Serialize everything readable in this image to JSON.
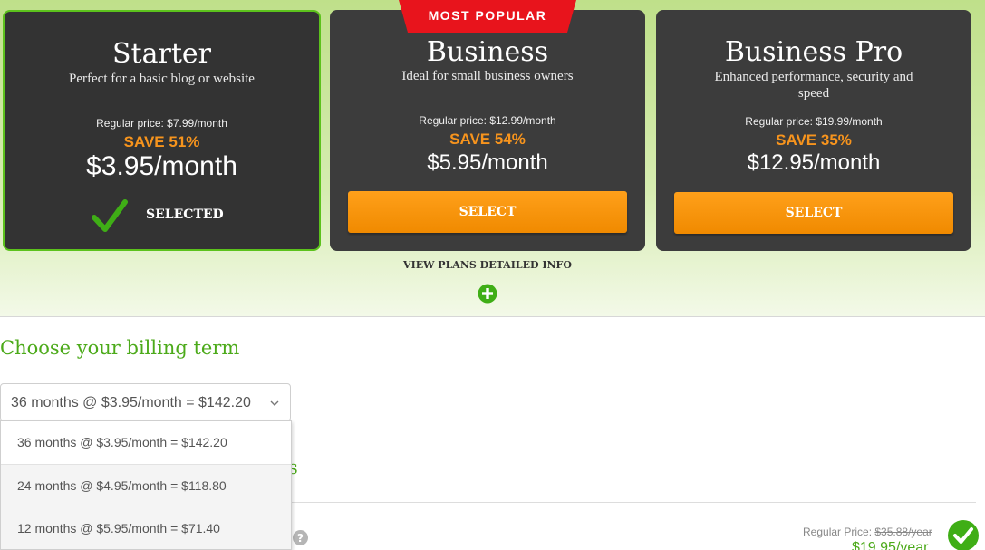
{
  "ribbon": {
    "label": "MOST POPULAR"
  },
  "plans": [
    {
      "name": "Starter",
      "description": "Perfect for a basic blog or website",
      "regular": "Regular price: $7.99/month",
      "save": "SAVE 51%",
      "price": "$3.95/month",
      "state_label": "SELECTED"
    },
    {
      "name": "Business",
      "description": "Ideal for small business owners",
      "regular": "Regular price: $12.99/month",
      "save": "SAVE 54%",
      "price": "$5.95/month",
      "button_label": "SELECT"
    },
    {
      "name": "Business Pro",
      "description": "Enhanced performance, security and speed",
      "regular": "Regular price: $19.99/month",
      "save": "SAVE 35%",
      "price": "$12.95/month",
      "button_label": "SELECT"
    }
  ],
  "view_plans_label": "VIEW PLANS DETAILED INFO",
  "billing": {
    "title": "Choose your billing term",
    "selected_value": "36 months @ $3.95/month = $142.20",
    "options": [
      "36 months @ $3.95/month = $142.20",
      "24 months @ $4.95/month = $118.80",
      "12 months @ $5.95/month = $71.40"
    ]
  },
  "extras": {
    "heading_fragment": "s",
    "regular_price_label": "Regular Price:",
    "regular_price_value": "$35.88/year",
    "final_price": "$19.95/year"
  },
  "colors": {
    "accent_green": "#4caa1a",
    "button_orange": "#f7941d",
    "ribbon_red": "#e8141c",
    "card_dark": "#3c3c3c"
  }
}
